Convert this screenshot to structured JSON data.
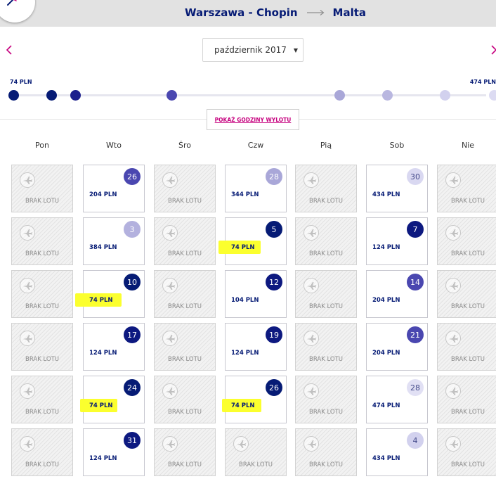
{
  "header": {
    "origin": "Warszawa - Chopin",
    "destination": "Malta",
    "brand_color": "#061b75",
    "accent_color": "#c6007e"
  },
  "month_selector": {
    "value": "październik 2017"
  },
  "price_range": {
    "min_label": "74 PLN",
    "max_label": "474 PLN"
  },
  "show_times_button": "POKAŻ GODZINY WYLOTU",
  "weekdays": [
    "Pon",
    "Wto",
    "Śro",
    "Czw",
    "Pią",
    "Sob",
    "Nie"
  ],
  "no_flight_label": "BRAK LOTU",
  "price_dots": [
    {
      "color": "#061b75"
    },
    {
      "color": "#061b75"
    },
    {
      "color": "#1c1f8c"
    },
    {
      "color": "#4a47b0"
    },
    {
      "color": "#a9a7d8"
    },
    {
      "color": "#b9b7e0"
    },
    {
      "color": "#d2d1ee"
    },
    {
      "color": "#dcdbf2"
    }
  ],
  "weeks": [
    [
      {
        "type": "none"
      },
      {
        "type": "flight",
        "day": "26",
        "price": "204 PLN",
        "badge_color": "#4a47b0",
        "badge_text_color": "#ffffff",
        "highlight": false
      },
      {
        "type": "none"
      },
      {
        "type": "flight",
        "day": "28",
        "price": "344 PLN",
        "badge_color": "#a9a7d8",
        "badge_text_color": "#ffffff",
        "highlight": false
      },
      {
        "type": "none"
      },
      {
        "type": "flight",
        "day": "30",
        "price": "434 PLN",
        "badge_color": "#d9d8f1",
        "badge_text_color": "#444a8a",
        "highlight": false
      },
      {
        "type": "none"
      }
    ],
    [
      {
        "type": "none"
      },
      {
        "type": "flight",
        "day": "3",
        "price": "384 PLN",
        "badge_color": "#b3b1de",
        "badge_text_color": "#ffffff",
        "highlight": false
      },
      {
        "type": "none"
      },
      {
        "type": "flight",
        "day": "5",
        "price": "74 PLN",
        "badge_color": "#061b75",
        "badge_text_color": "#ffffff",
        "highlight": true
      },
      {
        "type": "none"
      },
      {
        "type": "flight",
        "day": "7",
        "price": "124 PLN",
        "badge_color": "#0d1980",
        "badge_text_color": "#ffffff",
        "highlight": false
      },
      {
        "type": "none"
      }
    ],
    [
      {
        "type": "none"
      },
      {
        "type": "flight",
        "day": "10",
        "price": "74 PLN",
        "badge_color": "#061b75",
        "badge_text_color": "#ffffff",
        "highlight": true
      },
      {
        "type": "none"
      },
      {
        "type": "flight",
        "day": "12",
        "price": "104 PLN",
        "badge_color": "#0d1980",
        "badge_text_color": "#ffffff",
        "highlight": false
      },
      {
        "type": "none"
      },
      {
        "type": "flight",
        "day": "14",
        "price": "204 PLN",
        "badge_color": "#4a47b0",
        "badge_text_color": "#ffffff",
        "highlight": false
      },
      {
        "type": "none"
      }
    ],
    [
      {
        "type": "none"
      },
      {
        "type": "flight",
        "day": "17",
        "price": "124 PLN",
        "badge_color": "#0d1980",
        "badge_text_color": "#ffffff",
        "highlight": false
      },
      {
        "type": "none"
      },
      {
        "type": "flight",
        "day": "19",
        "price": "124 PLN",
        "badge_color": "#0d1980",
        "badge_text_color": "#ffffff",
        "highlight": false
      },
      {
        "type": "none"
      },
      {
        "type": "flight",
        "day": "21",
        "price": "204 PLN",
        "badge_color": "#4a47b0",
        "badge_text_color": "#ffffff",
        "highlight": false
      },
      {
        "type": "none"
      }
    ],
    [
      {
        "type": "none"
      },
      {
        "type": "flight",
        "day": "24",
        "price": "74 PLN",
        "badge_color": "#061b75",
        "badge_text_color": "#ffffff",
        "highlight": true
      },
      {
        "type": "none"
      },
      {
        "type": "flight",
        "day": "26",
        "price": "74 PLN",
        "badge_color": "#061b75",
        "badge_text_color": "#ffffff",
        "highlight": true
      },
      {
        "type": "none"
      },
      {
        "type": "flight",
        "day": "28",
        "price": "474 PLN",
        "badge_color": "#e1e0f4",
        "badge_text_color": "#444a8a",
        "highlight": false
      },
      {
        "type": "none"
      }
    ],
    [
      {
        "type": "none"
      },
      {
        "type": "flight",
        "day": "31",
        "price": "124 PLN",
        "badge_color": "#0d1980",
        "badge_text_color": "#ffffff",
        "highlight": false
      },
      {
        "type": "none"
      },
      {
        "type": "none"
      },
      {
        "type": "none"
      },
      {
        "type": "flight",
        "day": "4",
        "price": "434 PLN",
        "badge_color": "#d2d1ee",
        "badge_text_color": "#444a8a",
        "highlight": false
      },
      {
        "type": "none"
      }
    ]
  ]
}
